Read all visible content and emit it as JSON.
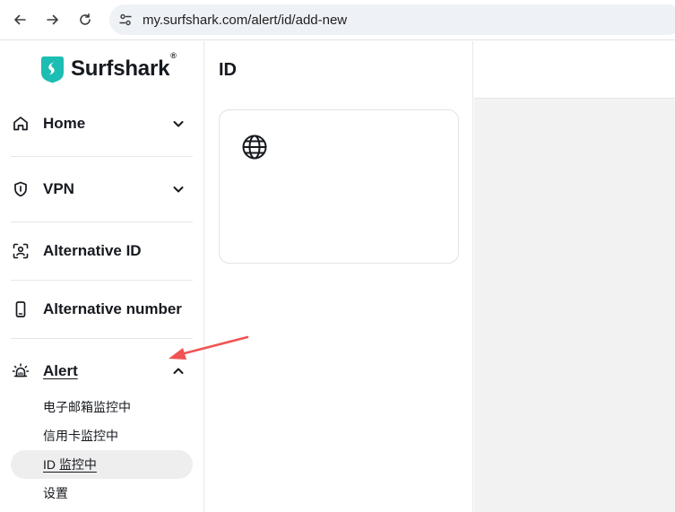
{
  "browser": {
    "url": "my.surfshark.com/alert/id/add-new",
    "back_icon": "arrow-left",
    "forward_icon": "arrow-right",
    "reload_icon": "reload",
    "site_info_icon": "tune"
  },
  "logo": {
    "name": "Surfshark",
    "registered": "®",
    "brand_color": "#1cbdb3"
  },
  "sidebar": {
    "items": [
      {
        "label": "Home",
        "icon": "home-icon",
        "chevron": "down"
      },
      {
        "label": "VPN",
        "icon": "shield-icon",
        "chevron": "down"
      },
      {
        "label": "Alternative ID",
        "icon": "user-scan-icon"
      },
      {
        "label": "Alternative number",
        "icon": "phone-icon"
      },
      {
        "label": "Alert",
        "icon": "alarm-icon",
        "chevron": "up",
        "active": true
      }
    ],
    "alert_subitems": [
      {
        "label": "电子邮箱监控中"
      },
      {
        "label": "信用卡监控中"
      },
      {
        "label": "ID 监控中",
        "active": true
      },
      {
        "label": "设置"
      }
    ]
  },
  "main": {
    "title": "ID",
    "card_icon": "globe-icon"
  },
  "annotation": {
    "arrow_color": "#f05454"
  }
}
